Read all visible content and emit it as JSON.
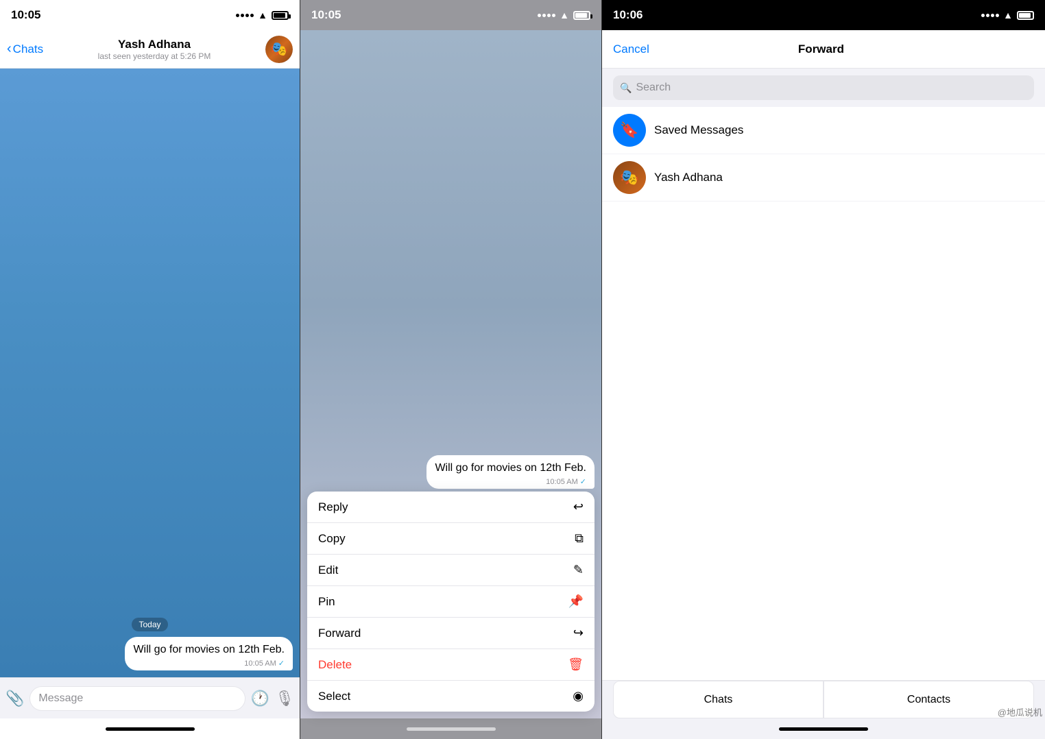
{
  "panel1": {
    "status_time": "10:05",
    "header_name": "Yash Adhana",
    "header_status": "last seen yesterday at 5:26 PM",
    "back_label": "Chats",
    "date_badge": "Today",
    "message_text": "Will go for movies on 12th Feb.",
    "message_time": "10:05 AM",
    "input_placeholder": "Message"
  },
  "panel2": {
    "status_time": "10:05",
    "message_text": "Will go for movies on 12th Feb.",
    "message_time": "10:05 AM",
    "menu_items": [
      {
        "label": "Reply",
        "icon": "↩",
        "delete": false
      },
      {
        "label": "Copy",
        "icon": "⧉",
        "delete": false
      },
      {
        "label": "Edit",
        "icon": "✎",
        "delete": false
      },
      {
        "label": "Pin",
        "icon": "📌",
        "delete": false
      },
      {
        "label": "Forward",
        "icon": "↪",
        "delete": false
      },
      {
        "label": "Delete",
        "icon": "🗑",
        "delete": true
      },
      {
        "label": "Select",
        "icon": "◉",
        "delete": false
      }
    ]
  },
  "panel3": {
    "status_time": "10:06",
    "cancel_label": "Cancel",
    "title": "Forward",
    "search_placeholder": "Search",
    "contacts": [
      {
        "name": "Saved Messages",
        "type": "saved"
      },
      {
        "name": "Yash Adhana",
        "type": "yash"
      }
    ],
    "tabs": [
      "Chats",
      "Contacts"
    ]
  },
  "watermark": "@地瓜说机"
}
